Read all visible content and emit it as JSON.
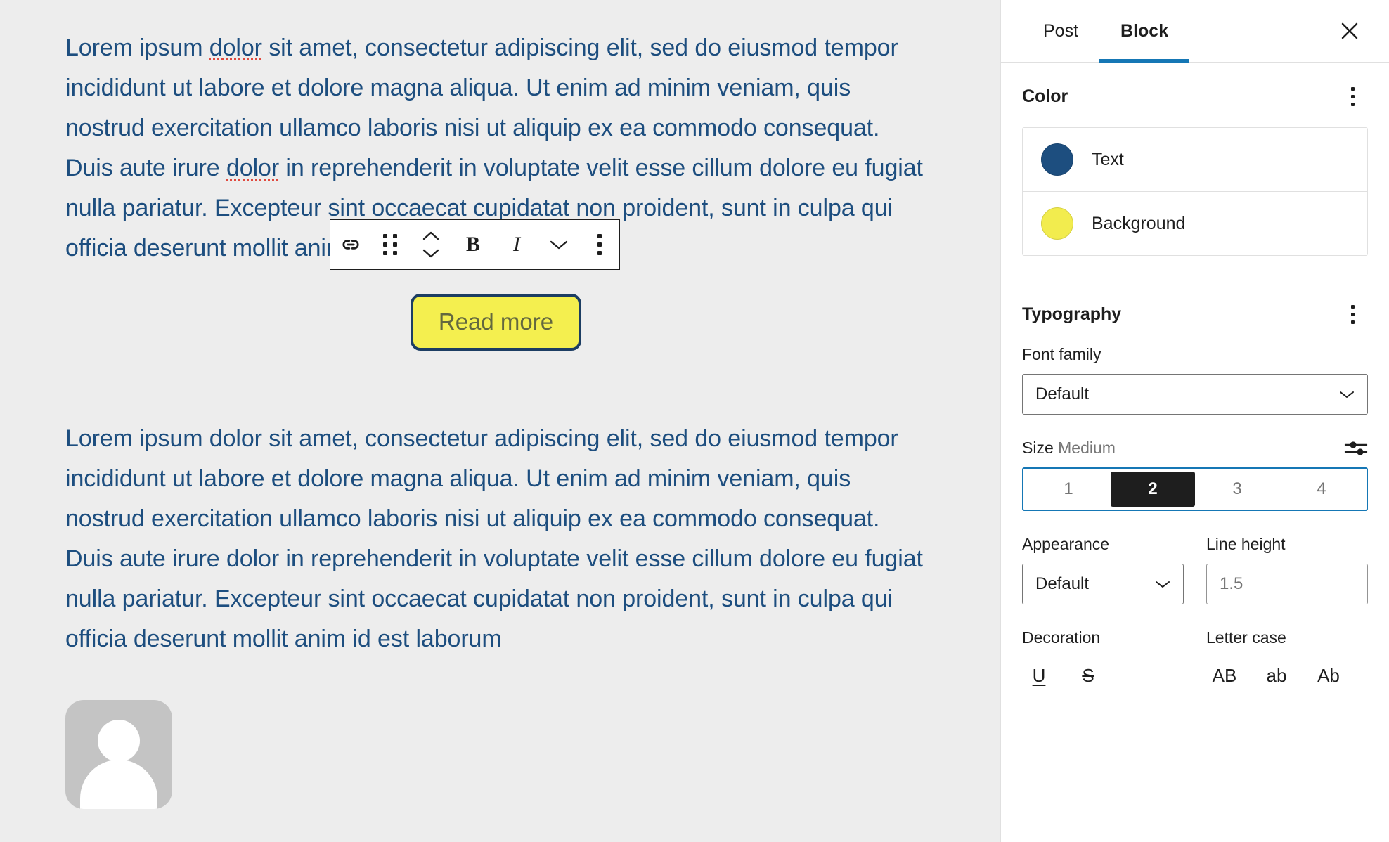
{
  "editor": {
    "paragraph_1": "Lorem ipsum dolor sit amet, consectetur adipiscing elit, sed do eiusmod tempor incididunt ut labore et dolore magna aliqua. Ut enim ad minim veniam, quis nostrud exercitation ullamco laboris nisi ut aliquip ex ea commodo consequat. Duis aute irure dolor in reprehenderit in voluptate velit esse cillum dolore eu fugiat nulla pariatur. Excepteur sint occaecat cupidatat non proident, sunt in culpa qui officia deserunt mollit anim id est laborum",
    "paragraph_2": "Lorem ipsum dolor sit amet, consectetur adipiscing elit, sed do eiusmod tempor incididunt ut labore et dolore magna aliqua. Ut enim ad minim veniam, quis nostrud exercitation ullamco laboris nisi ut aliquip ex ea commodo consequat. Duis aute irure dolor in reprehenderit in voluptate velit esse cillum dolore eu fugiat nulla pariatur. Excepteur sint occaecat cupidatat non proident, sunt in culpa qui officia deserunt mollit anim id est laborum",
    "button_label": "Read more",
    "button_background": "#f4ef4f",
    "button_border_color": "#1c3d63",
    "button_text_color": "#63683f",
    "text_color": "#1d4e7f",
    "canvas_background": "#ededed",
    "avatar_alt": "placeholder-avatar"
  },
  "block_toolbar": {
    "items": [
      {
        "name": "button-block-icon",
        "label": "Button"
      },
      {
        "name": "drag-handle-icon",
        "label": "Drag"
      },
      {
        "name": "move-updown-icon",
        "label": "Move up or down"
      },
      {
        "name": "bold-icon",
        "label": "B"
      },
      {
        "name": "italic-icon",
        "label": "I"
      },
      {
        "name": "more-rich-text-icon",
        "label": "More"
      },
      {
        "name": "options-icon",
        "label": "Options"
      }
    ],
    "bold_label": "B",
    "italic_label": "I"
  },
  "sidebar": {
    "tabs": [
      {
        "label": "Post",
        "active": false
      },
      {
        "label": "Block",
        "active": true
      }
    ],
    "close_label": "Close settings",
    "color": {
      "title": "Color",
      "options_label": "Color options",
      "items": [
        {
          "label": "Text",
          "color": "#1d4e7f"
        },
        {
          "label": "Background",
          "color": "#f2ec4e"
        }
      ]
    },
    "typography": {
      "title": "Typography",
      "options_label": "Typography options",
      "font_family_label": "Font family",
      "font_family_value": "Default",
      "size_label": "Size",
      "size_value": "Medium",
      "size_options": [
        "1",
        "2",
        "3",
        "4"
      ],
      "size_selected": "2",
      "set_custom_size_label": "Set custom size",
      "appearance_label": "Appearance",
      "appearance_value": "Default",
      "line_height_label": "Line height",
      "line_height_value": "1.5",
      "decoration_label": "Decoration",
      "decoration_options": [
        {
          "label": "U",
          "name": "underline-icon"
        },
        {
          "label": "S",
          "name": "strikethrough-icon"
        }
      ],
      "letter_case_label": "Letter case",
      "letter_case_options": [
        {
          "label": "AB",
          "name": "uppercase-icon"
        },
        {
          "label": "ab",
          "name": "lowercase-icon"
        },
        {
          "label": "Ab",
          "name": "capitalize-icon"
        }
      ]
    }
  },
  "theme": {
    "accent_blue": "#1577b5",
    "border_gray": "#e0e0e0",
    "text_dark": "#1e1e1e",
    "text_muted": "#757575"
  }
}
